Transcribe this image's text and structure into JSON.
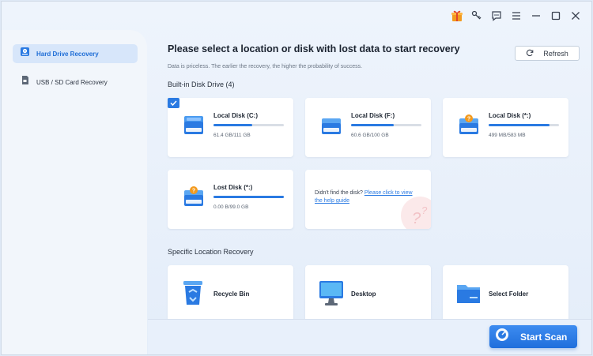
{
  "sidebar": {
    "items": [
      {
        "label": "Hard Drive Recovery",
        "icon": "hard-drive-icon",
        "active": true
      },
      {
        "label": "USB / SD Card Recovery",
        "icon": "sd-card-icon",
        "active": false
      }
    ]
  },
  "main": {
    "heading": "Please select a location or disk with lost data to start recovery",
    "subheading": "Data is priceless. The earlier the recovery, the higher the probability of success.",
    "refresh_label": "Refresh",
    "builtin_title": "Built-in Disk Drive (4)",
    "disks": [
      {
        "name": "Local Disk (C:)",
        "size": "61.4 GB/111 GB",
        "usage": 0.55,
        "icon": "system-disk-icon",
        "selected": true
      },
      {
        "name": "Local Disk (F:)",
        "size": "60.6 GB/100 GB",
        "usage": 0.61,
        "icon": "disk-icon",
        "selected": false
      },
      {
        "name": "Local Disk (*:)",
        "size": "499 MB/583 MB",
        "usage": 0.86,
        "icon": "unknown-disk-icon",
        "selected": false
      },
      {
        "name": "Lost Disk (*:)",
        "size": "0.00  B/99.0 GB",
        "usage": 1.0,
        "icon": "unknown-disk-icon",
        "selected": false
      }
    ],
    "help": {
      "text": "Didn't find the disk?",
      "link": "Please click to view the help guide"
    },
    "location_title": "Specific Location Recovery",
    "locations": [
      {
        "label": "Recycle Bin",
        "icon": "recycle-bin-icon"
      },
      {
        "label": "Desktop",
        "icon": "desktop-icon"
      },
      {
        "label": "Select Folder",
        "icon": "folder-icon"
      }
    ]
  },
  "footer": {
    "scan_label": "Start Scan"
  },
  "colors": {
    "accent": "#2a7ae2",
    "sidebar_active": "#d7e6fa"
  }
}
